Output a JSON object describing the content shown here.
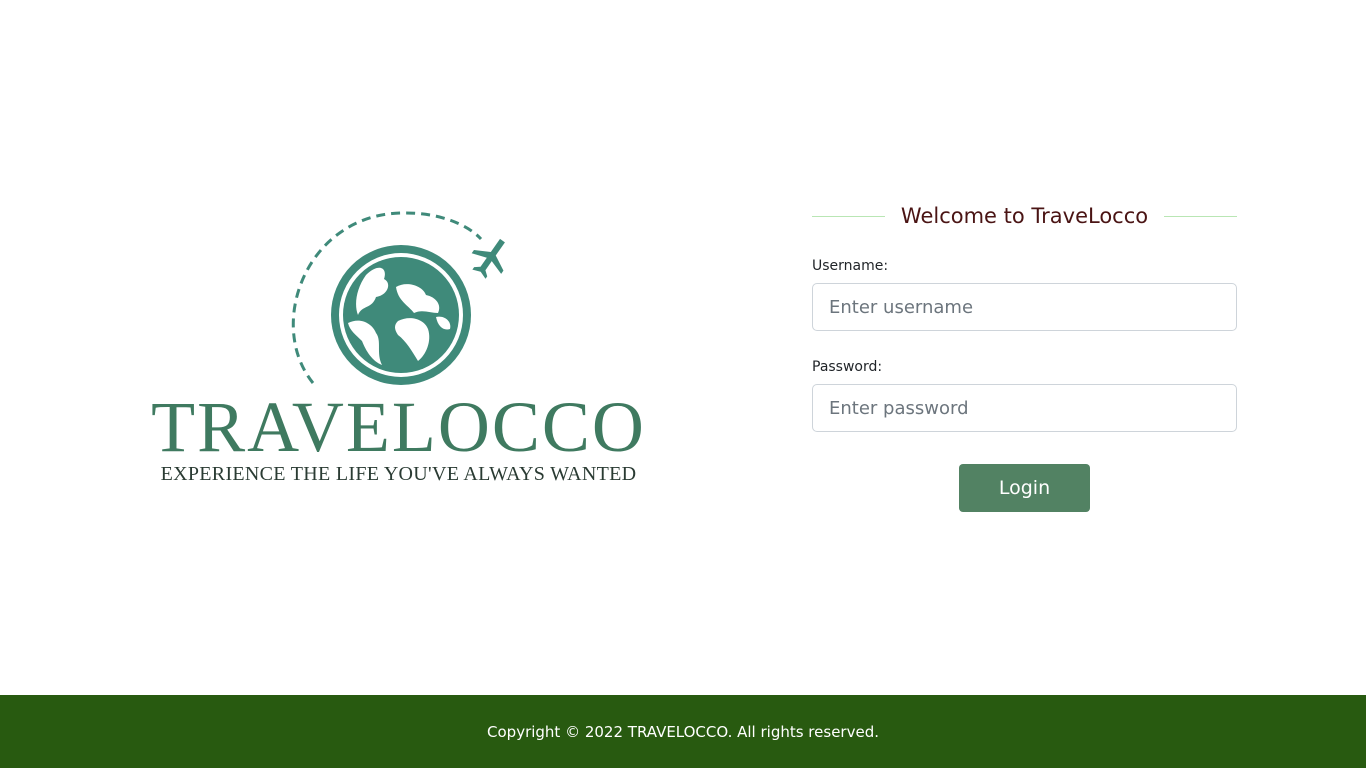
{
  "logo": {
    "brand": "TRAVELOCCO",
    "tagline": "EXPERIENCE THE LIFE YOU'VE ALWAYS WANTED",
    "icons": [
      "globe-icon",
      "airplane-icon"
    ],
    "color": "#3f8a7a"
  },
  "login_form": {
    "title": "Welcome to TraveLocco",
    "username_label": "Username:",
    "username_placeholder": "Enter username",
    "username_value": "",
    "password_label": "Password:",
    "password_placeholder": "Enter password",
    "password_value": "",
    "login_label": "Login"
  },
  "footer": {
    "copyright": "Copyright © 2022 TRAVELOCCO. All rights reserved."
  },
  "colors": {
    "accent": "#528263",
    "footer_bg": "#285a10",
    "title": "#4a1414",
    "divider": "#b9e6b4"
  }
}
